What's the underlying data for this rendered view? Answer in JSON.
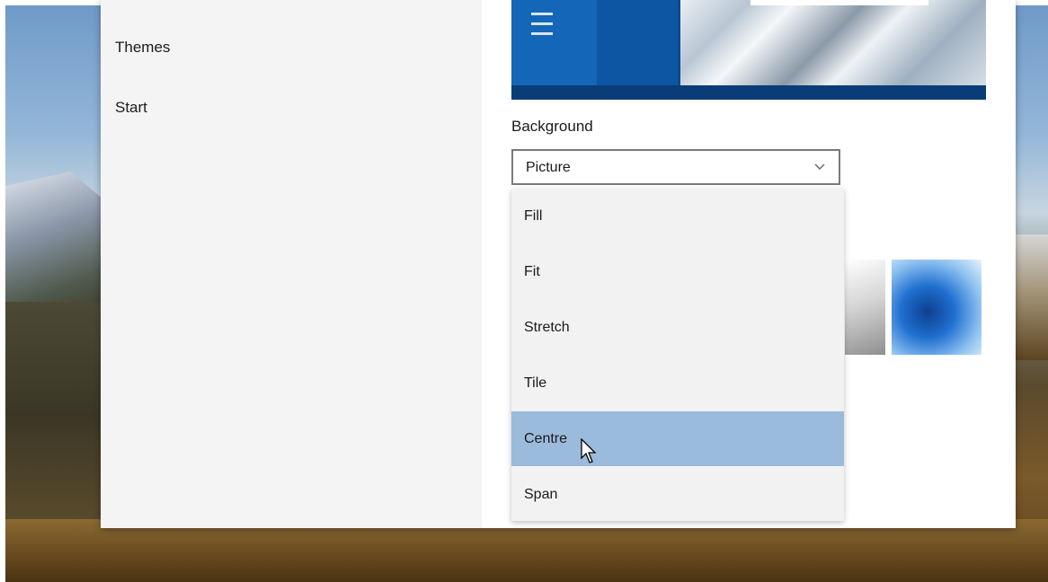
{
  "nav": {
    "items": [
      {
        "label": "Themes"
      },
      {
        "label": "Start"
      }
    ]
  },
  "background": {
    "label": "Background",
    "selected_value": "Picture",
    "fit_options": [
      {
        "label": "Fill"
      },
      {
        "label": "Fit"
      },
      {
        "label": "Stretch"
      },
      {
        "label": "Tile"
      },
      {
        "label": "Centre",
        "highlighted": true
      },
      {
        "label": "Span"
      }
    ]
  },
  "colors": {
    "accent": "#0e4a8c",
    "highlight": "#9bbbdd",
    "nav_bg": "#f4f4f4"
  }
}
